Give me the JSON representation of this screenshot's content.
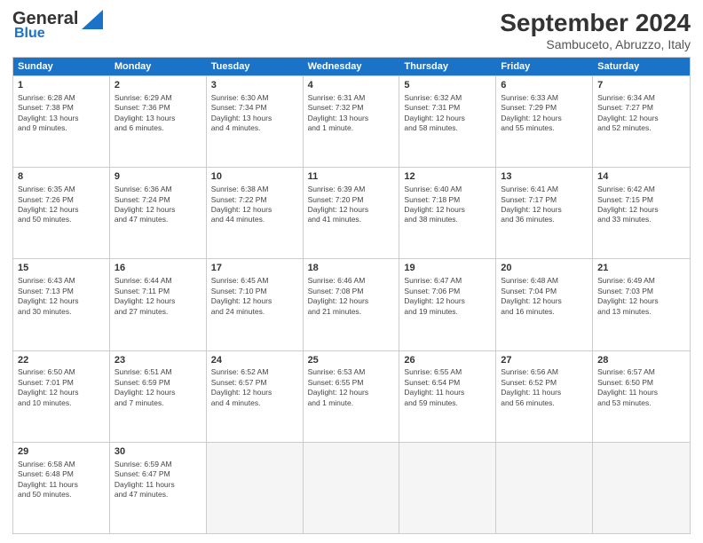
{
  "logo": {
    "line1": "General",
    "line2": "Blue"
  },
  "title": "September 2024",
  "location": "Sambuceto, Abruzzo, Italy",
  "days": [
    "Sunday",
    "Monday",
    "Tuesday",
    "Wednesday",
    "Thursday",
    "Friday",
    "Saturday"
  ],
  "rows": [
    [
      {
        "day": "1",
        "info": "Sunrise: 6:28 AM\nSunset: 7:38 PM\nDaylight: 13 hours\nand 9 minutes."
      },
      {
        "day": "2",
        "info": "Sunrise: 6:29 AM\nSunset: 7:36 PM\nDaylight: 13 hours\nand 6 minutes."
      },
      {
        "day": "3",
        "info": "Sunrise: 6:30 AM\nSunset: 7:34 PM\nDaylight: 13 hours\nand 4 minutes."
      },
      {
        "day": "4",
        "info": "Sunrise: 6:31 AM\nSunset: 7:32 PM\nDaylight: 13 hours\nand 1 minute."
      },
      {
        "day": "5",
        "info": "Sunrise: 6:32 AM\nSunset: 7:31 PM\nDaylight: 12 hours\nand 58 minutes."
      },
      {
        "day": "6",
        "info": "Sunrise: 6:33 AM\nSunset: 7:29 PM\nDaylight: 12 hours\nand 55 minutes."
      },
      {
        "day": "7",
        "info": "Sunrise: 6:34 AM\nSunset: 7:27 PM\nDaylight: 12 hours\nand 52 minutes."
      }
    ],
    [
      {
        "day": "8",
        "info": "Sunrise: 6:35 AM\nSunset: 7:26 PM\nDaylight: 12 hours\nand 50 minutes."
      },
      {
        "day": "9",
        "info": "Sunrise: 6:36 AM\nSunset: 7:24 PM\nDaylight: 12 hours\nand 47 minutes."
      },
      {
        "day": "10",
        "info": "Sunrise: 6:38 AM\nSunset: 7:22 PM\nDaylight: 12 hours\nand 44 minutes."
      },
      {
        "day": "11",
        "info": "Sunrise: 6:39 AM\nSunset: 7:20 PM\nDaylight: 12 hours\nand 41 minutes."
      },
      {
        "day": "12",
        "info": "Sunrise: 6:40 AM\nSunset: 7:18 PM\nDaylight: 12 hours\nand 38 minutes."
      },
      {
        "day": "13",
        "info": "Sunrise: 6:41 AM\nSunset: 7:17 PM\nDaylight: 12 hours\nand 36 minutes."
      },
      {
        "day": "14",
        "info": "Sunrise: 6:42 AM\nSunset: 7:15 PM\nDaylight: 12 hours\nand 33 minutes."
      }
    ],
    [
      {
        "day": "15",
        "info": "Sunrise: 6:43 AM\nSunset: 7:13 PM\nDaylight: 12 hours\nand 30 minutes."
      },
      {
        "day": "16",
        "info": "Sunrise: 6:44 AM\nSunset: 7:11 PM\nDaylight: 12 hours\nand 27 minutes."
      },
      {
        "day": "17",
        "info": "Sunrise: 6:45 AM\nSunset: 7:10 PM\nDaylight: 12 hours\nand 24 minutes."
      },
      {
        "day": "18",
        "info": "Sunrise: 6:46 AM\nSunset: 7:08 PM\nDaylight: 12 hours\nand 21 minutes."
      },
      {
        "day": "19",
        "info": "Sunrise: 6:47 AM\nSunset: 7:06 PM\nDaylight: 12 hours\nand 19 minutes."
      },
      {
        "day": "20",
        "info": "Sunrise: 6:48 AM\nSunset: 7:04 PM\nDaylight: 12 hours\nand 16 minutes."
      },
      {
        "day": "21",
        "info": "Sunrise: 6:49 AM\nSunset: 7:03 PM\nDaylight: 12 hours\nand 13 minutes."
      }
    ],
    [
      {
        "day": "22",
        "info": "Sunrise: 6:50 AM\nSunset: 7:01 PM\nDaylight: 12 hours\nand 10 minutes."
      },
      {
        "day": "23",
        "info": "Sunrise: 6:51 AM\nSunset: 6:59 PM\nDaylight: 12 hours\nand 7 minutes."
      },
      {
        "day": "24",
        "info": "Sunrise: 6:52 AM\nSunset: 6:57 PM\nDaylight: 12 hours\nand 4 minutes."
      },
      {
        "day": "25",
        "info": "Sunrise: 6:53 AM\nSunset: 6:55 PM\nDaylight: 12 hours\nand 1 minute."
      },
      {
        "day": "26",
        "info": "Sunrise: 6:55 AM\nSunset: 6:54 PM\nDaylight: 11 hours\nand 59 minutes."
      },
      {
        "day": "27",
        "info": "Sunrise: 6:56 AM\nSunset: 6:52 PM\nDaylight: 11 hours\nand 56 minutes."
      },
      {
        "day": "28",
        "info": "Sunrise: 6:57 AM\nSunset: 6:50 PM\nDaylight: 11 hours\nand 53 minutes."
      }
    ],
    [
      {
        "day": "29",
        "info": "Sunrise: 6:58 AM\nSunset: 6:48 PM\nDaylight: 11 hours\nand 50 minutes."
      },
      {
        "day": "30",
        "info": "Sunrise: 6:59 AM\nSunset: 6:47 PM\nDaylight: 11 hours\nand 47 minutes."
      },
      {
        "day": "",
        "info": ""
      },
      {
        "day": "",
        "info": ""
      },
      {
        "day": "",
        "info": ""
      },
      {
        "day": "",
        "info": ""
      },
      {
        "day": "",
        "info": ""
      }
    ]
  ]
}
